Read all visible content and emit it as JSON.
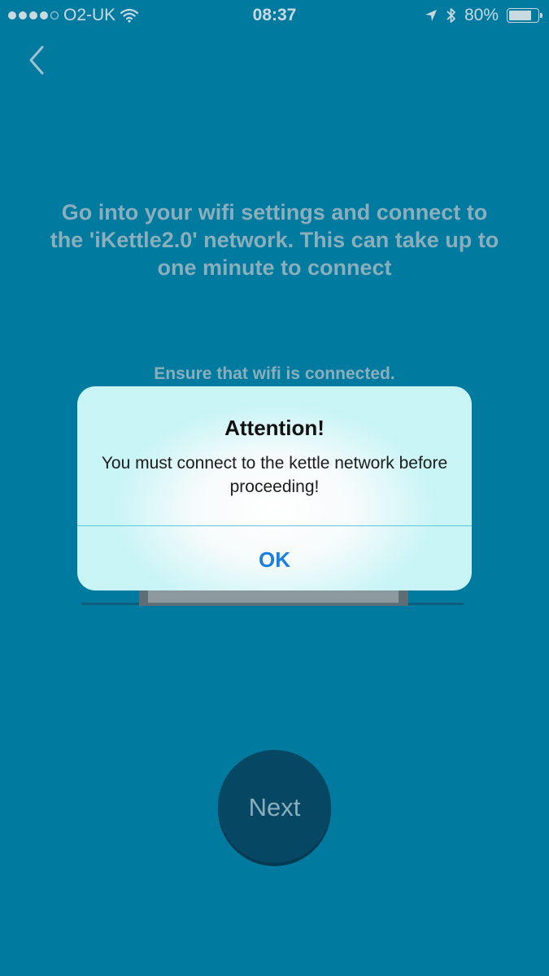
{
  "status_bar": {
    "carrier": "O2-UK",
    "time": "08:37",
    "battery": "80%",
    "battery_level": 0.8,
    "icons": [
      "signal-dots-icon",
      "wifi-icon",
      "location-arrow-icon",
      "bluetooth-icon",
      "battery-icon"
    ]
  },
  "nav": {
    "back_icon": "chevron-left-icon"
  },
  "main": {
    "instruction": "Go into your wifi settings and connect to the 'iKettle2.0' network. This can take up to one minute to connect",
    "wifi_note": "Ensure that wifi is connected.",
    "next_label": "Next"
  },
  "alert": {
    "title": "Attention!",
    "message": "You must connect to the kettle network before proceeding!",
    "ok_label": "OK"
  },
  "colors": {
    "background": "#017aa0",
    "next_button": "#064864",
    "alert_ok": "#1a7fe0"
  }
}
